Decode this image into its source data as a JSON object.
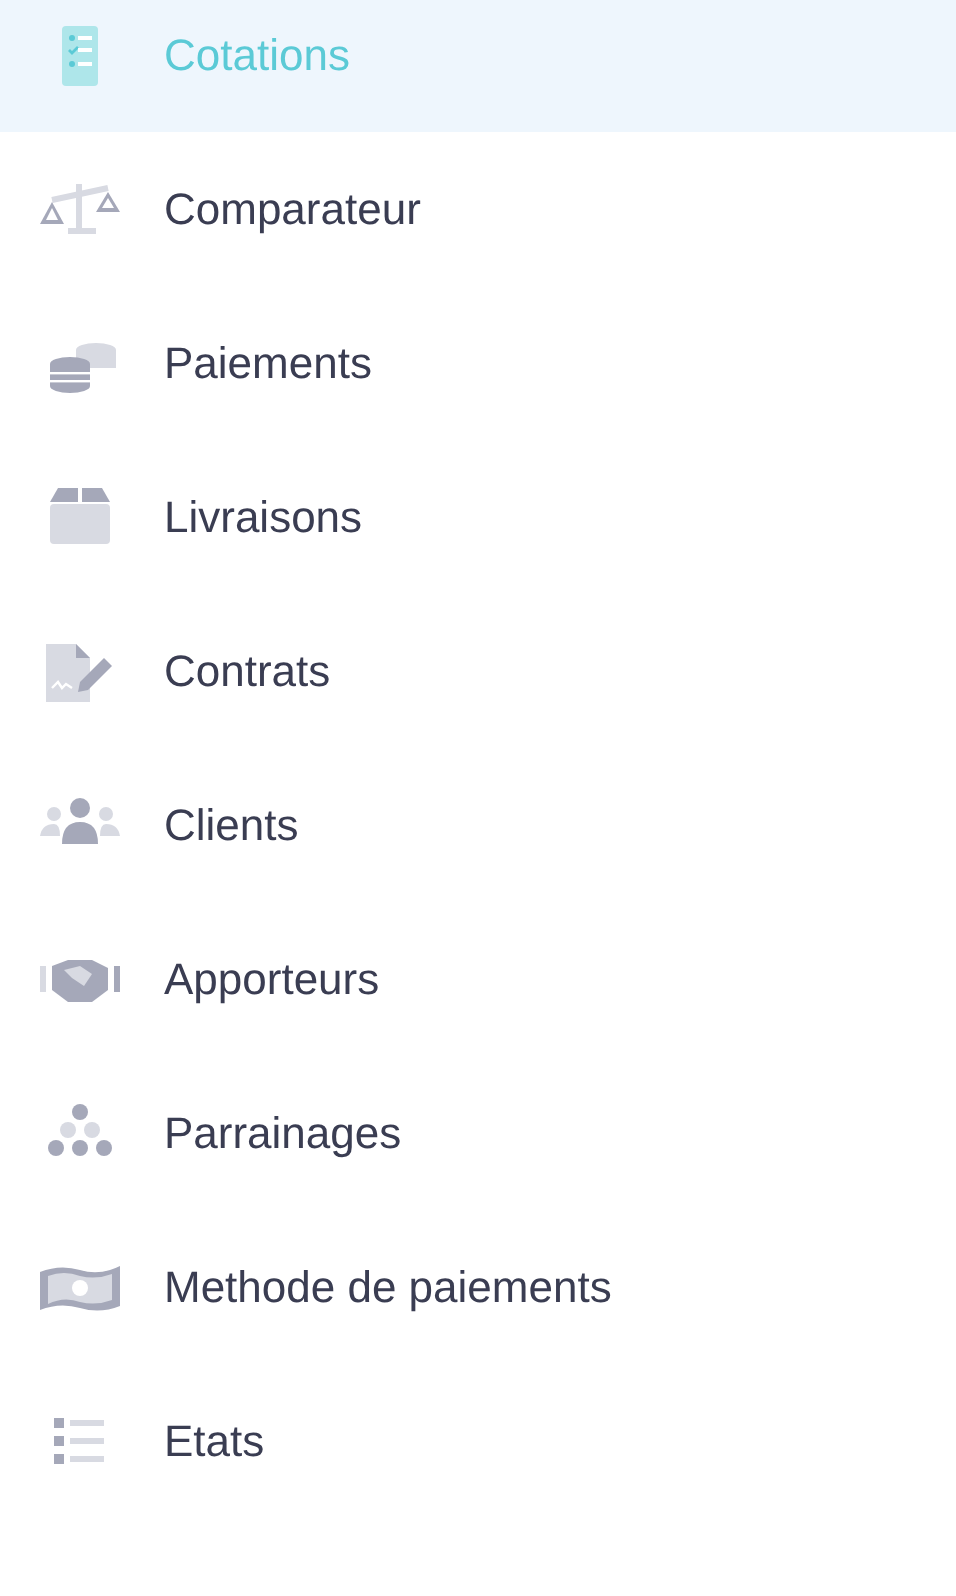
{
  "menu": [
    {
      "label": "Cotations",
      "selected": true
    },
    {
      "label": "Comparateur",
      "selected": false
    },
    {
      "label": "Paiements",
      "selected": false
    },
    {
      "label": "Livraisons",
      "selected": false
    },
    {
      "label": "Contrats",
      "selected": false
    },
    {
      "label": "Clients",
      "selected": false
    },
    {
      "label": "Apporteurs",
      "selected": false
    },
    {
      "label": "Parrainages",
      "selected": false
    },
    {
      "label": "Methode de paiements",
      "selected": false
    },
    {
      "label": "Etats",
      "selected": false
    }
  ]
}
